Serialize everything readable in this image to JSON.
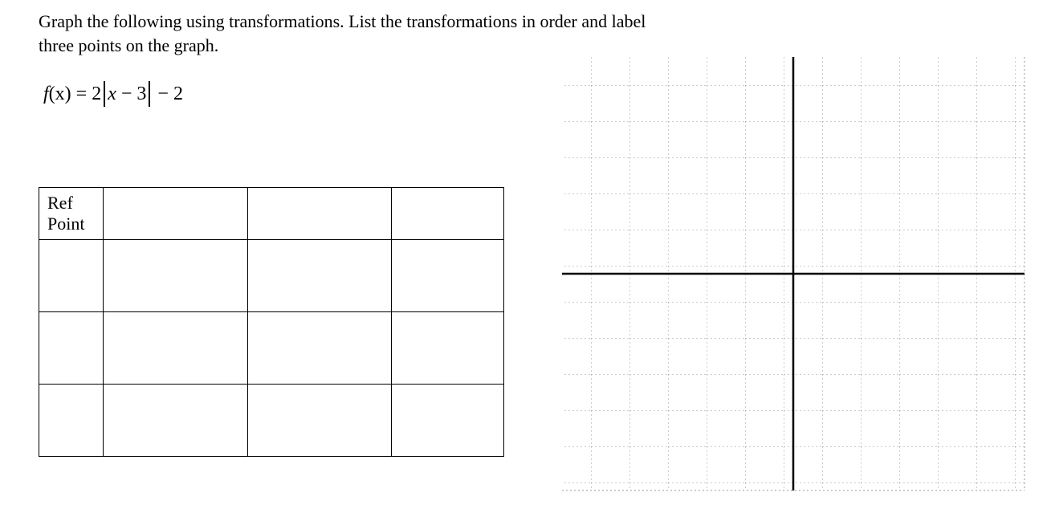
{
  "instructions_line1": "Graph the following using transformations.  List the transformations in order and label",
  "instructions_line2": "three points on the graph.",
  "equation": {
    "fx": "f",
    "of_x": "(x)",
    "eq": " = ",
    "coef": "2",
    "inner": "x − 3",
    "trailing": " − 2"
  },
  "table": {
    "header_cell": "Ref\nPoint",
    "rows": 4,
    "cols": 4
  },
  "chart_data": {
    "type": "grid",
    "title": "",
    "xlabel": "",
    "ylabel": "",
    "x_range": [
      -6,
      6
    ],
    "y_range": [
      -6,
      6
    ],
    "x_ticks": 12,
    "y_ticks": 12,
    "grid": true,
    "series": []
  }
}
